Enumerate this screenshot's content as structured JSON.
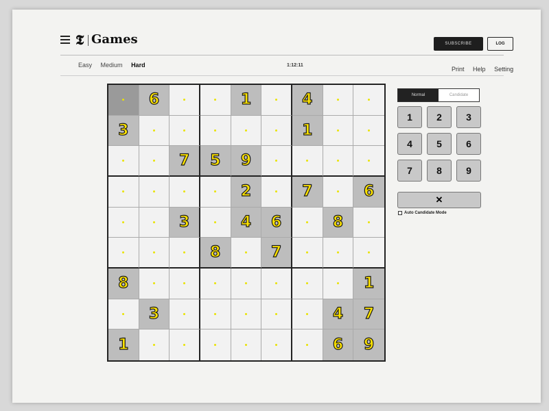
{
  "header": {
    "menu_icon": "hamburger-icon",
    "logo_mark": "𝕿",
    "logo_text": "Games",
    "subscribe_label": "SUBSCRIBE",
    "login_label": "LOG"
  },
  "nav": {
    "difficulties": [
      "Easy",
      "Medium",
      "Hard"
    ],
    "active_difficulty": "Hard",
    "timer": "1:12:11",
    "links": [
      "Print",
      "Help",
      "Setting"
    ]
  },
  "board": {
    "givens": [
      [
        "",
        "6",
        "",
        "",
        "1",
        "",
        "4",
        "",
        ""
      ],
      [
        "3",
        "",
        "",
        "",
        "",
        "",
        "1",
        "",
        ""
      ],
      [
        "",
        "",
        "7",
        "5",
        "9",
        "",
        "",
        "",
        ""
      ],
      [
        "",
        "",
        "",
        "",
        "2",
        "",
        "7",
        "",
        "6"
      ],
      [
        "",
        "",
        "3",
        "",
        "4",
        "6",
        "",
        "8",
        ""
      ],
      [
        "",
        "",
        "",
        "8",
        "",
        "7",
        "",
        "",
        ""
      ],
      [
        "8",
        "",
        "",
        "",
        "",
        "",
        "",
        "",
        "1"
      ],
      [
        "",
        "3",
        "",
        "",
        "",
        "",
        "",
        "4",
        "7"
      ],
      [
        "1",
        "",
        "",
        "",
        "",
        "",
        "",
        "6",
        "9"
      ]
    ],
    "selected_cell": [
      0,
      0
    ]
  },
  "controls": {
    "mode_normal": "Normal",
    "mode_candidate": "Candidate",
    "keys": [
      "1",
      "2",
      "3",
      "4",
      "5",
      "6",
      "7",
      "8",
      "9"
    ],
    "erase_label": "✕",
    "auto_candidate_label": "Auto Candidate Mode"
  }
}
